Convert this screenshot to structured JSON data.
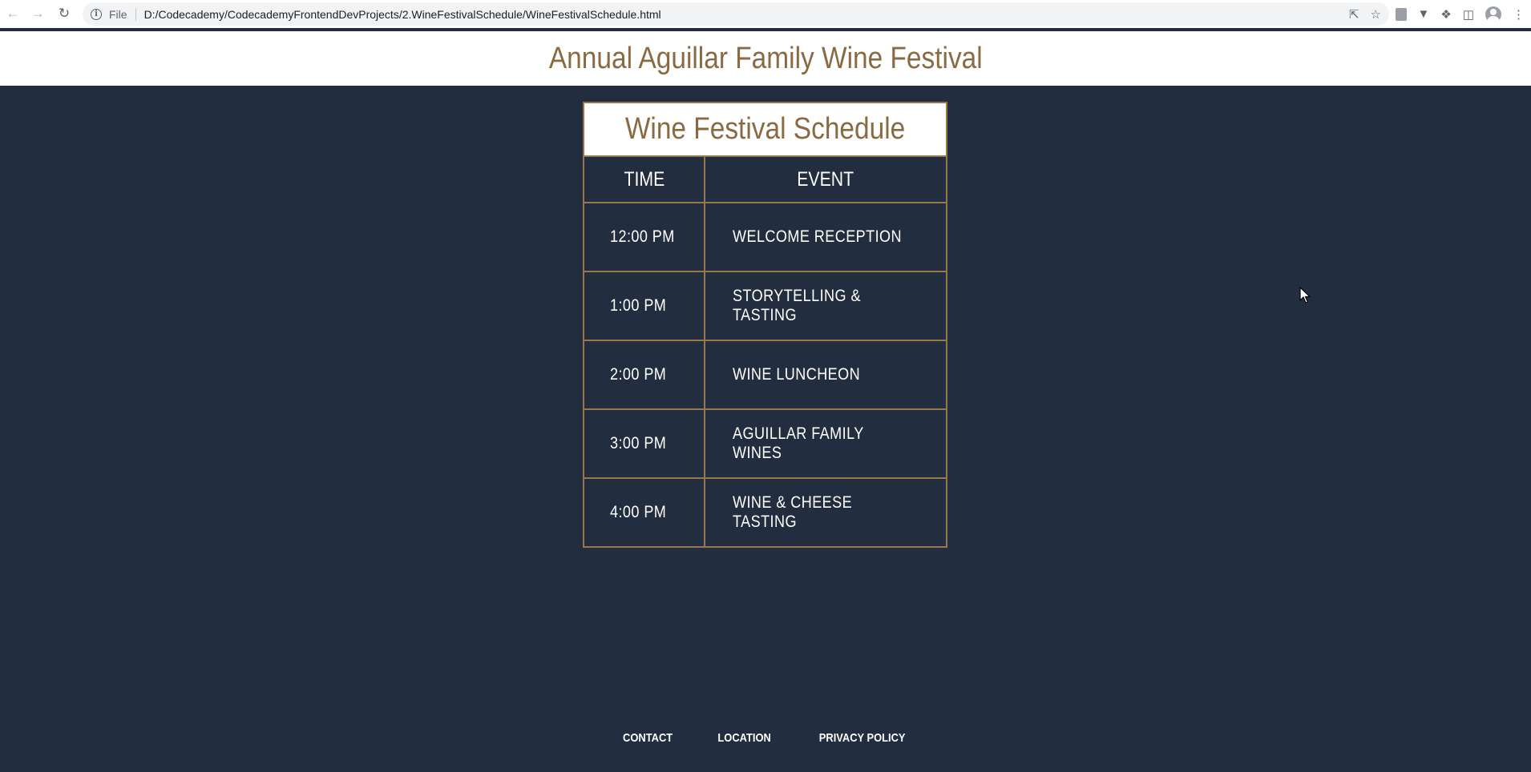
{
  "browser": {
    "back_icon": "back-arrow-icon",
    "forward_icon": "forward-arrow-icon",
    "reload_icon": "reload-icon",
    "file_label": "File",
    "url": "D:/Codecademy/CodecademyFrontendDevProjects/2.WineFestivalSchedule/WineFestivalSchedule.html"
  },
  "header": {
    "title": "Annual Aguillar Family Wine Festival"
  },
  "schedule": {
    "caption": "Wine Festival Schedule",
    "columns": [
      "TIME",
      "EVENT"
    ],
    "rows": [
      {
        "time": "12:00 PM",
        "event": "WELCOME RECEPTION"
      },
      {
        "time": "1:00 PM",
        "event": "STORYTELLING & TASTING"
      },
      {
        "time": "2:00 PM",
        "event": "WINE LUNCHEON"
      },
      {
        "time": "3:00 PM",
        "event": "AGUILLAR FAMILY WINES"
      },
      {
        "time": "4:00 PM",
        "event": "WINE & CHEESE TASTING"
      }
    ]
  },
  "footer": {
    "links": [
      "CONTACT",
      "LOCATION",
      "PRIVACY POLICY"
    ]
  },
  "colors": {
    "background": "#232d40",
    "accent": "#8a6a42",
    "border": "#9a7748",
    "text": "#ffffff"
  }
}
